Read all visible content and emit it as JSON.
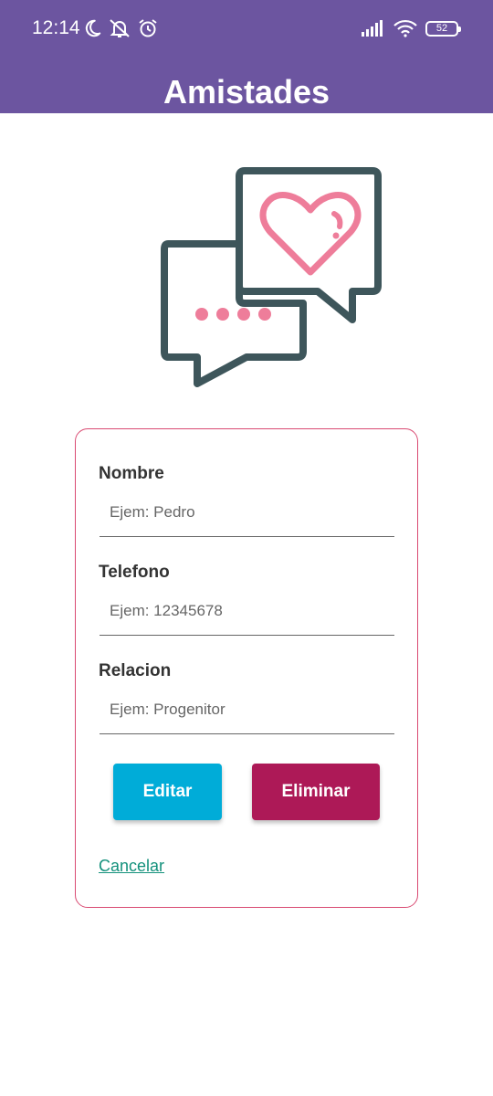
{
  "status_bar": {
    "time": "12:14",
    "battery_level": "52",
    "left_icons": [
      "moon-icon",
      "notifications-off-icon",
      "alarm-icon"
    ],
    "right_icons": [
      "signal-icon",
      "wifi-icon",
      "battery-icon"
    ]
  },
  "header": {
    "title": "Amistades",
    "background_color": "#6c55a0"
  },
  "illustration": {
    "icon": "chat-bubbles-heart-icon",
    "stroke_color": "#3e565b",
    "accent_color": "#ee7d9a"
  },
  "form": {
    "fields": [
      {
        "label": "Nombre",
        "placeholder": "Ejem: Pedro",
        "value": ""
      },
      {
        "label": "Telefono",
        "placeholder": "Ejem: 12345678",
        "value": ""
      },
      {
        "label": "Relacion",
        "placeholder": "Ejem: Progenitor",
        "value": ""
      }
    ],
    "edit_label": "Editar",
    "delete_label": "Eliminar",
    "cancel_label": "Cancelar",
    "border_color": "#d94a72"
  }
}
